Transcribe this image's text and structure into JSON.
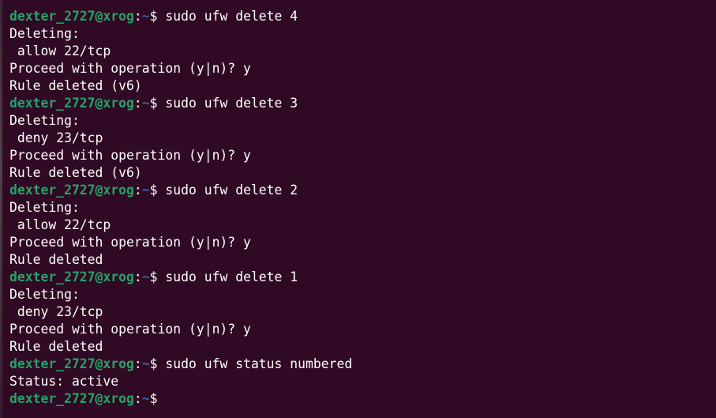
{
  "prompt": {
    "user_host": "dexter_2727@xrog",
    "colon": ":",
    "path": "~",
    "symbol": "$ "
  },
  "blocks": [
    {
      "command": "sudo ufw delete 4",
      "output": [
        "Deleting:",
        " allow 22/tcp",
        "Proceed with operation (y|n)? y",
        "Rule deleted (v6)"
      ]
    },
    {
      "command": "sudo ufw delete 3",
      "output": [
        "Deleting:",
        " deny 23/tcp",
        "Proceed with operation (y|n)? y",
        "Rule deleted (v6)"
      ]
    },
    {
      "command": "sudo ufw delete 2",
      "output": [
        "Deleting:",
        " allow 22/tcp",
        "Proceed with operation (y|n)? y",
        "Rule deleted"
      ]
    },
    {
      "command": "sudo ufw delete 1",
      "output": [
        "Deleting:",
        " deny 23/tcp",
        "Proceed with operation (y|n)? y",
        "Rule deleted"
      ]
    },
    {
      "command": "sudo ufw status numbered",
      "output": [
        "Status: active"
      ]
    }
  ],
  "final_prompt_command": "",
  "colors": {
    "background": "#300a24",
    "user_host": "#26a269",
    "path": "#3465a4",
    "text": "#ffffff"
  }
}
